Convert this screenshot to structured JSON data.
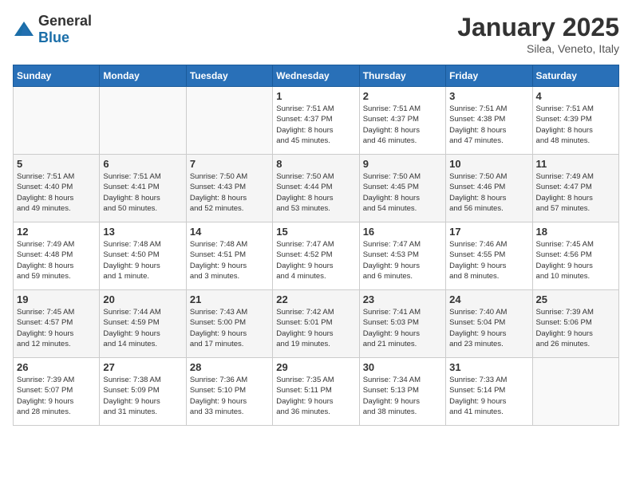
{
  "header": {
    "logo_general": "General",
    "logo_blue": "Blue",
    "month": "January 2025",
    "location": "Silea, Veneto, Italy"
  },
  "weekdays": [
    "Sunday",
    "Monday",
    "Tuesday",
    "Wednesday",
    "Thursday",
    "Friday",
    "Saturday"
  ],
  "weeks": [
    [
      {
        "day": "",
        "info": ""
      },
      {
        "day": "",
        "info": ""
      },
      {
        "day": "",
        "info": ""
      },
      {
        "day": "1",
        "info": "Sunrise: 7:51 AM\nSunset: 4:37 PM\nDaylight: 8 hours\nand 45 minutes."
      },
      {
        "day": "2",
        "info": "Sunrise: 7:51 AM\nSunset: 4:37 PM\nDaylight: 8 hours\nand 46 minutes."
      },
      {
        "day": "3",
        "info": "Sunrise: 7:51 AM\nSunset: 4:38 PM\nDaylight: 8 hours\nand 47 minutes."
      },
      {
        "day": "4",
        "info": "Sunrise: 7:51 AM\nSunset: 4:39 PM\nDaylight: 8 hours\nand 48 minutes."
      }
    ],
    [
      {
        "day": "5",
        "info": "Sunrise: 7:51 AM\nSunset: 4:40 PM\nDaylight: 8 hours\nand 49 minutes."
      },
      {
        "day": "6",
        "info": "Sunrise: 7:51 AM\nSunset: 4:41 PM\nDaylight: 8 hours\nand 50 minutes."
      },
      {
        "day": "7",
        "info": "Sunrise: 7:50 AM\nSunset: 4:43 PM\nDaylight: 8 hours\nand 52 minutes."
      },
      {
        "day": "8",
        "info": "Sunrise: 7:50 AM\nSunset: 4:44 PM\nDaylight: 8 hours\nand 53 minutes."
      },
      {
        "day": "9",
        "info": "Sunrise: 7:50 AM\nSunset: 4:45 PM\nDaylight: 8 hours\nand 54 minutes."
      },
      {
        "day": "10",
        "info": "Sunrise: 7:50 AM\nSunset: 4:46 PM\nDaylight: 8 hours\nand 56 minutes."
      },
      {
        "day": "11",
        "info": "Sunrise: 7:49 AM\nSunset: 4:47 PM\nDaylight: 8 hours\nand 57 minutes."
      }
    ],
    [
      {
        "day": "12",
        "info": "Sunrise: 7:49 AM\nSunset: 4:48 PM\nDaylight: 8 hours\nand 59 minutes."
      },
      {
        "day": "13",
        "info": "Sunrise: 7:48 AM\nSunset: 4:50 PM\nDaylight: 9 hours\nand 1 minute."
      },
      {
        "day": "14",
        "info": "Sunrise: 7:48 AM\nSunset: 4:51 PM\nDaylight: 9 hours\nand 3 minutes."
      },
      {
        "day": "15",
        "info": "Sunrise: 7:47 AM\nSunset: 4:52 PM\nDaylight: 9 hours\nand 4 minutes."
      },
      {
        "day": "16",
        "info": "Sunrise: 7:47 AM\nSunset: 4:53 PM\nDaylight: 9 hours\nand 6 minutes."
      },
      {
        "day": "17",
        "info": "Sunrise: 7:46 AM\nSunset: 4:55 PM\nDaylight: 9 hours\nand 8 minutes."
      },
      {
        "day": "18",
        "info": "Sunrise: 7:45 AM\nSunset: 4:56 PM\nDaylight: 9 hours\nand 10 minutes."
      }
    ],
    [
      {
        "day": "19",
        "info": "Sunrise: 7:45 AM\nSunset: 4:57 PM\nDaylight: 9 hours\nand 12 minutes."
      },
      {
        "day": "20",
        "info": "Sunrise: 7:44 AM\nSunset: 4:59 PM\nDaylight: 9 hours\nand 14 minutes."
      },
      {
        "day": "21",
        "info": "Sunrise: 7:43 AM\nSunset: 5:00 PM\nDaylight: 9 hours\nand 17 minutes."
      },
      {
        "day": "22",
        "info": "Sunrise: 7:42 AM\nSunset: 5:01 PM\nDaylight: 9 hours\nand 19 minutes."
      },
      {
        "day": "23",
        "info": "Sunrise: 7:41 AM\nSunset: 5:03 PM\nDaylight: 9 hours\nand 21 minutes."
      },
      {
        "day": "24",
        "info": "Sunrise: 7:40 AM\nSunset: 5:04 PM\nDaylight: 9 hours\nand 23 minutes."
      },
      {
        "day": "25",
        "info": "Sunrise: 7:39 AM\nSunset: 5:06 PM\nDaylight: 9 hours\nand 26 minutes."
      }
    ],
    [
      {
        "day": "26",
        "info": "Sunrise: 7:39 AM\nSunset: 5:07 PM\nDaylight: 9 hours\nand 28 minutes."
      },
      {
        "day": "27",
        "info": "Sunrise: 7:38 AM\nSunset: 5:09 PM\nDaylight: 9 hours\nand 31 minutes."
      },
      {
        "day": "28",
        "info": "Sunrise: 7:36 AM\nSunset: 5:10 PM\nDaylight: 9 hours\nand 33 minutes."
      },
      {
        "day": "29",
        "info": "Sunrise: 7:35 AM\nSunset: 5:11 PM\nDaylight: 9 hours\nand 36 minutes."
      },
      {
        "day": "30",
        "info": "Sunrise: 7:34 AM\nSunset: 5:13 PM\nDaylight: 9 hours\nand 38 minutes."
      },
      {
        "day": "31",
        "info": "Sunrise: 7:33 AM\nSunset: 5:14 PM\nDaylight: 9 hours\nand 41 minutes."
      },
      {
        "day": "",
        "info": ""
      }
    ]
  ]
}
